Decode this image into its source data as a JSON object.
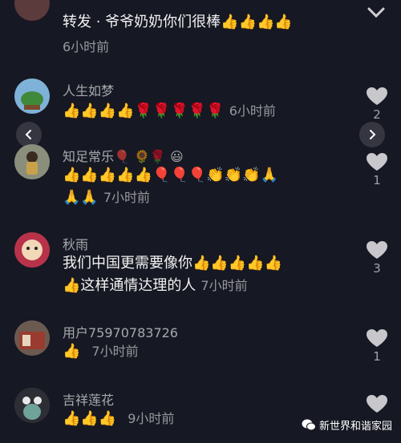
{
  "comments": [
    {
      "username": "",
      "text_lines": [
        "转发 · 爷爷奶奶你们很棒👍👍👍👍"
      ],
      "time": "6小时前",
      "time_inline": false,
      "like_count": ""
    },
    {
      "username": "人生如梦",
      "text_lines": [
        "👍👍👍👍🌹🌹🌹🌹🌹"
      ],
      "time": "6小时前",
      "time_inline": true,
      "like_count": "2"
    },
    {
      "username": "知足常乐🎈 🌻🌹 😃",
      "text_lines": [
        "👍👍👍👍👍🎈🎈🎈👏👏👏🙏",
        "🙏🙏"
      ],
      "time": "7小时前",
      "time_inline": true,
      "like_count": "1"
    },
    {
      "username": "秋雨",
      "text_lines": [
        "我们中国更需要像你👍👍👍👍👍",
        "👍这样通情达理的人"
      ],
      "time": "7小时前",
      "time_inline": true,
      "like_count": "3"
    },
    {
      "username": "用户75970783726",
      "text_lines": [
        "👍"
      ],
      "time": "7小时前",
      "time_inline": true,
      "like_count": "1"
    },
    {
      "username": "吉祥莲花",
      "text_lines": [
        "👍👍👍"
      ],
      "time": "9小时前",
      "time_inline": true,
      "like_count": ""
    }
  ],
  "watermark": {
    "text": "新世界和谐家园"
  },
  "colors": {
    "background": "#161823",
    "like_icon": "#c8c8cc"
  },
  "icons": {
    "like": "heart-icon",
    "prev": "chevron-left-icon",
    "next": "chevron-right-icon",
    "top": "chevron-down-icon",
    "wechat": "wechat-icon"
  }
}
